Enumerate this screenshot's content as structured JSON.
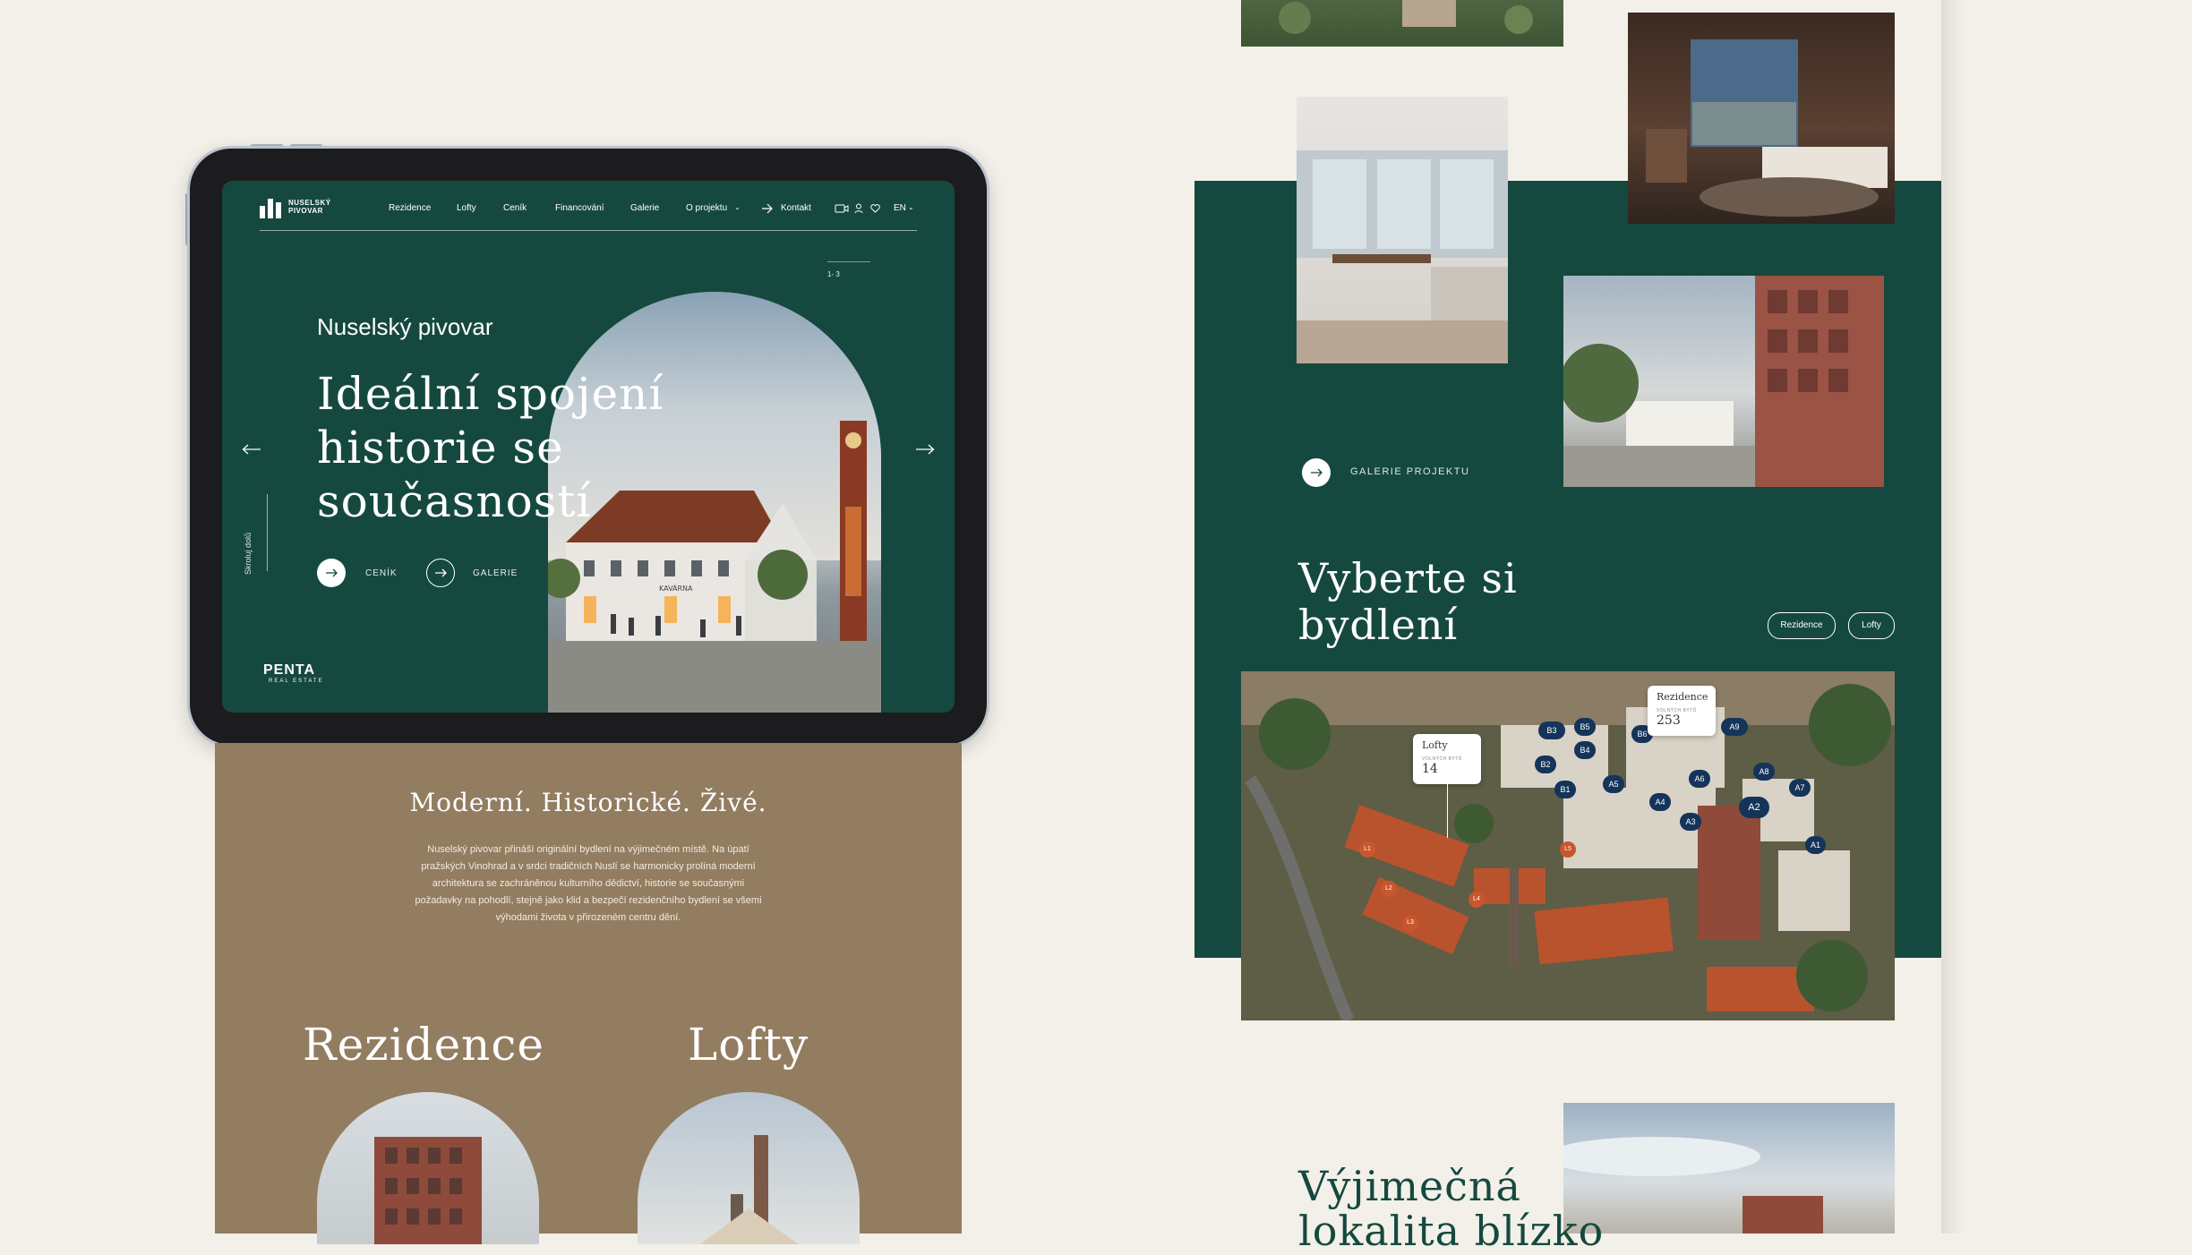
{
  "nav": {
    "logo_line1": "NUSELSKÝ",
    "logo_line2": "PIVOVAR",
    "items": [
      "Rezidence",
      "Lofty",
      "Ceník",
      "Financování",
      "Galerie",
      "O projektu"
    ],
    "contact": "Kontakt",
    "lang": "EN"
  },
  "hero": {
    "slide_counter": "1- 3",
    "kicker": "Nuselský pivovar",
    "headline": "Ideální spojení historie se současností",
    "btn_price": "CENÍK",
    "btn_gallery": "GALERIE",
    "side_label": "Skroluj dolů",
    "brand": "PENTA",
    "brand_sub": "REAL ESTATE",
    "sign": "KAVÁRNA"
  },
  "intro": {
    "heading": "Moderní. Historické. Živé.",
    "paragraph": "Nuselský pivovar přináší originální bydlení na výjimečném místě. Na úpatí pražských Vinohrad a v srdci tradičních Nuslí se harmonicky prolíná moderní architektura se zachráněnou kulturního dědictví, historie se současnými požadavky na pohodlí, stejně jako klid a bezpečí rezidenčního bydlení se všemi výhodami života v přirozeném centru dění."
  },
  "types": {
    "rezidence": "Rezidence",
    "lofty": "Lofty"
  },
  "gallery": {
    "label": "GALERIE PROJEKTU"
  },
  "choose": {
    "heading": "Vyberte si bydlení",
    "pills": [
      "Rezidence",
      "Lofty"
    ],
    "map_card_rezidence": {
      "title": "Rezidence",
      "sub": "VOLNÝCH BYTŮ",
      "count": "253"
    },
    "map_card_lofty": {
      "title": "Lofty",
      "sub": "VOLNÝCH BYTŮ",
      "count": "14"
    },
    "pins": [
      "B3",
      "B5",
      "B6",
      "A9",
      "B4",
      "B2",
      "B1",
      "A5",
      "A4",
      "A6",
      "A8",
      "A7",
      "A3",
      "A2",
      "A1"
    ],
    "loft_pins": [
      "L1",
      "L2",
      "L3",
      "L4",
      "L5"
    ]
  },
  "location": {
    "heading": "Výjimečná lokalita blízko"
  },
  "colors": {
    "green": "#15493f",
    "brown": "#927d61",
    "cream": "#f3f0e9",
    "pin": "#14345a"
  }
}
